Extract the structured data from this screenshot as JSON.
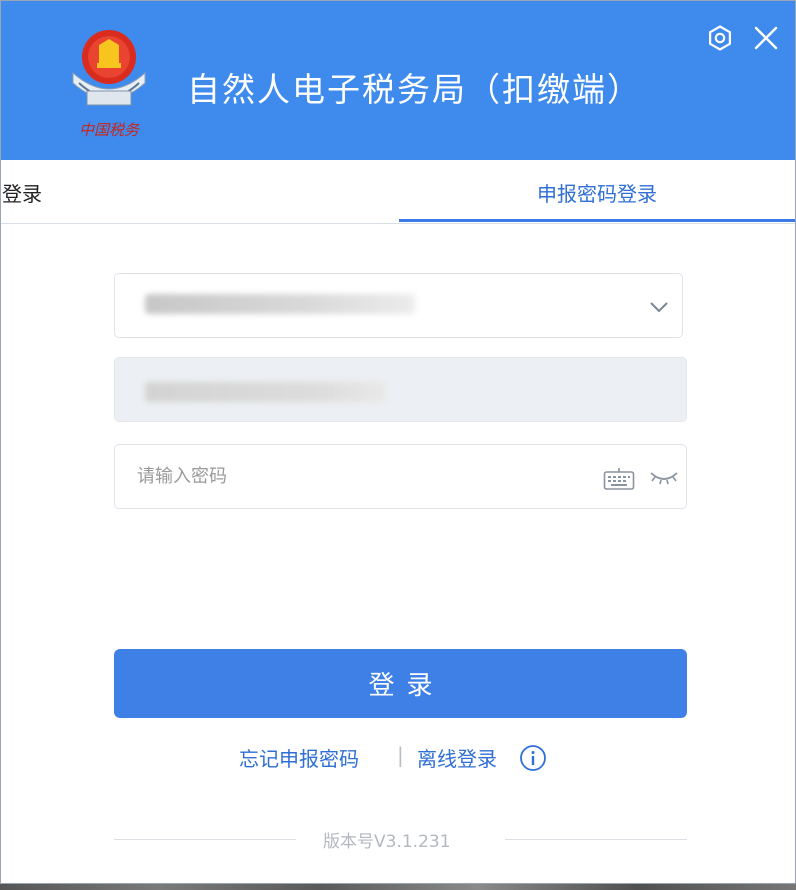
{
  "window": {
    "title": "自然人电子税务局（扣缴端）",
    "emblem_text": "中国税务"
  },
  "tabs": [
    {
      "label": "实名登录",
      "active": false
    },
    {
      "label": "申报密码登录",
      "active": true
    }
  ],
  "form": {
    "account_value": "",
    "idno_value": "",
    "password_placeholder": "请输入密码",
    "login_label": "登录"
  },
  "links": {
    "forget": "忘记申报密码",
    "separator": "|",
    "offline": "离线登录"
  },
  "footer": {
    "version": "版本号V3.1.231"
  },
  "colors": {
    "header": "#3f8bed",
    "accent": "#2f6fd6",
    "button": "#3f80e7"
  },
  "icons": {
    "settings": "gear-icon",
    "close": "close-icon",
    "dropdown": "chevron-down-icon",
    "keyboard": "keyboard-icon",
    "password_toggle": "eye-closed-icon",
    "info": "info-icon"
  }
}
